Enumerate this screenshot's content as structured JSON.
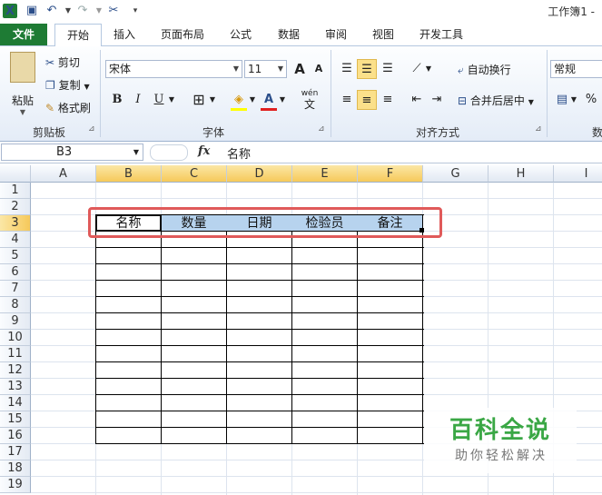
{
  "window": {
    "title": "工作簿1 -"
  },
  "quick_access": {
    "undo_icon": "undo-icon",
    "redo_icon": "redo-icon"
  },
  "tabs": [
    {
      "label": "文件"
    },
    {
      "label": "开始"
    },
    {
      "label": "插入"
    },
    {
      "label": "页面布局"
    },
    {
      "label": "公式"
    },
    {
      "label": "数据"
    },
    {
      "label": "审阅"
    },
    {
      "label": "视图"
    },
    {
      "label": "开发工具"
    }
  ],
  "ribbon": {
    "clipboard": {
      "label": "剪贴板",
      "paste": "粘贴",
      "cut": "剪切",
      "copy": "复制",
      "format_painter": "格式刷"
    },
    "font": {
      "label": "字体",
      "family": "宋体",
      "size": "11",
      "bold": "B",
      "italic": "I",
      "underline": "U",
      "grow": "A",
      "shrink": "A",
      "font_color": "A",
      "phonetic": "wén"
    },
    "alignment": {
      "label": "对齐方式",
      "wrap": "自动换行",
      "merge": "合并后居中"
    },
    "number": {
      "label": "数",
      "format": "常规",
      "percent": "%"
    }
  },
  "formula_bar": {
    "name_box": "B3",
    "fx": "fx",
    "value": "名称"
  },
  "columns": [
    "A",
    "B",
    "C",
    "D",
    "E",
    "F",
    "G",
    "H",
    "I"
  ],
  "rows": [
    "1",
    "2",
    "3",
    "4",
    "5",
    "6",
    "7",
    "8",
    "9",
    "10",
    "11",
    "12",
    "13",
    "14",
    "15",
    "16",
    "17",
    "18",
    "19"
  ],
  "table": {
    "headers": [
      "名称",
      "数量",
      "日期",
      "检验员",
      "备注"
    ]
  },
  "watermark": {
    "title": "百科全说",
    "subtitle": "助你轻松解决"
  }
}
